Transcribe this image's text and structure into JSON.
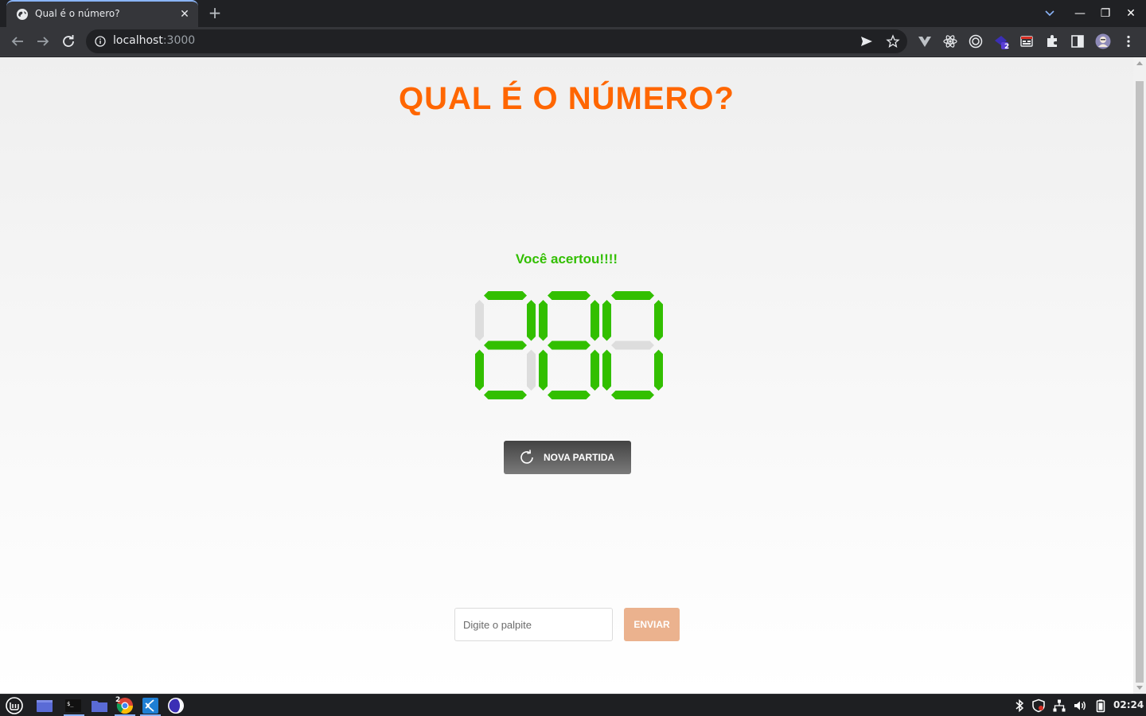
{
  "browser": {
    "tab_title": "Qual é o número?",
    "tab_close": "✕",
    "new_tab": "+",
    "url_host": "localhost",
    "url_port": ":3000",
    "window_controls": {
      "minimize": "—",
      "maximize": "❐",
      "close": "✕"
    },
    "extension_badge": "2"
  },
  "page": {
    "title": "QUAL É O NÚMERO?",
    "status_message": "Você acertou!!!!",
    "display_digits": [
      "2",
      "8",
      "0"
    ],
    "restart_label": "NOVA PARTIDA",
    "guess_placeholder": "Digite o palpite",
    "guess_value": "",
    "send_label": "ENVIAR"
  },
  "colors": {
    "title": "#ff6600",
    "status": "#32bf00",
    "segment_on": "#32bf00",
    "segment_off": "#dddddd",
    "send_button": "#ebb28e"
  },
  "taskbar": {
    "clock": "02:24",
    "apps": [
      "mint-menu-icon",
      "show-desktop-icon",
      "terminal-icon",
      "files-icon",
      "chrome-icon",
      "vscode-icon",
      "app-circle-icon"
    ],
    "chrome_badge": "2"
  }
}
